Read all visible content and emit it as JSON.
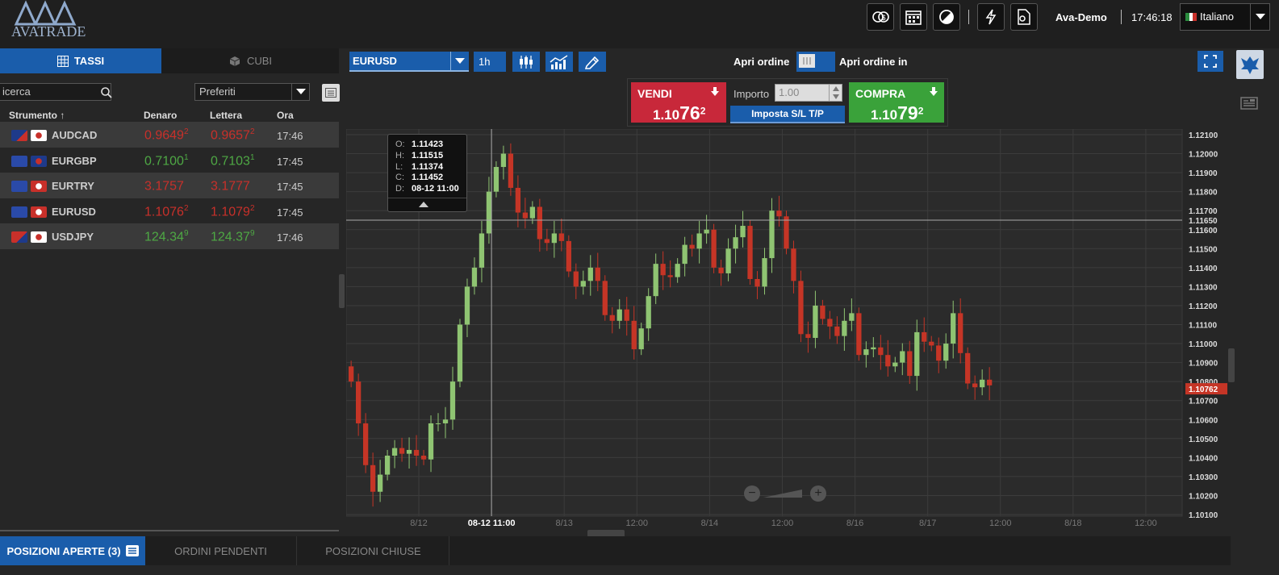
{
  "brand": {
    "logo_text": "AVATRADE"
  },
  "topbar": {
    "user": "Ava-Demo",
    "clock": "17:46:18",
    "language": "Italiano",
    "icons": [
      "currency-exchange-icon",
      "calendar-icon",
      "contrast-icon",
      "lightning-icon",
      "document-settings-icon"
    ]
  },
  "left": {
    "tabs": {
      "rates": "TASSI",
      "cubes": "CUBI"
    },
    "search_value": "icerca",
    "filter": "Preferiti",
    "headers": {
      "instrument": "Strumento",
      "bid": "Denaro",
      "ask": "Lettera",
      "time": "Ora"
    },
    "rows": [
      {
        "symbol": "AUDCAD",
        "bid_main": "0.9649",
        "bid_pip": "2",
        "ask_main": "0.9657",
        "ask_pip": "2",
        "time": "17:46",
        "dir": "red"
      },
      {
        "symbol": "EURGBP",
        "bid_main": "0.7100",
        "bid_pip": "1",
        "ask_main": "0.7103",
        "ask_pip": "1",
        "time": "17:45",
        "dir": "green"
      },
      {
        "symbol": "EURTRY",
        "bid_main": "3.1757",
        "bid_pip": "",
        "ask_main": "3.1777",
        "ask_pip": "",
        "time": "17:45",
        "dir": "red"
      },
      {
        "symbol": "EURUSD",
        "bid_main": "1.1076",
        "bid_pip": "2",
        "ask_main": "1.1079",
        "ask_pip": "2",
        "time": "17:45",
        "dir": "red"
      },
      {
        "symbol": "USDJPY",
        "bid_main": "124.34",
        "bid_pip": "9",
        "ask_main": "124.37",
        "ask_pip": "9",
        "time": "17:46",
        "dir": "green"
      }
    ]
  },
  "chart_toolbar": {
    "symbol": "EURUSD",
    "timeframe": "1h",
    "open_order": "Apri ordine",
    "open_order_in": "Apri ordine in"
  },
  "order": {
    "sell_label": "VENDI",
    "sell_pre": "1.10",
    "sell_big": "76",
    "sell_pip": "2",
    "buy_label": "COMPRA",
    "buy_pre": "1.10",
    "buy_big": "79",
    "buy_pip": "2",
    "amount_label": "Importo",
    "amount_value": "1.00",
    "sltp_label": "Imposta S/L T/P"
  },
  "tooltip": {
    "o_label": "O:",
    "o": "1.11423",
    "h_label": "H:",
    "h": "1.11515",
    "l_label": "L:",
    "l": "1.11374",
    "c_label": "C:",
    "c": "1.11452",
    "d_label": "D:",
    "d": "08-12 11:00"
  },
  "chart_data": {
    "type": "candlestick",
    "symbol": "EURUSD",
    "timeframe": "1h",
    "ylim": [
      1.101,
      1.121
    ],
    "y_ticks": [
      "1.10100",
      "1.10200",
      "1.10300",
      "1.10400",
      "1.10500",
      "1.10600",
      "1.10700",
      "1.10800",
      "1.10900",
      "1.11000",
      "1.11100",
      "1.11200",
      "1.11300",
      "1.11400",
      "1.11500",
      "1.11600",
      "1.11700",
      "1.11800",
      "1.11900",
      "1.12000",
      "1.12100"
    ],
    "hover_price": "1.11650",
    "last_price": "1.10762",
    "x_labels": [
      {
        "label": "8/12",
        "bold": false
      },
      {
        "label": "08-12 11:00",
        "bold": true
      },
      {
        "label": "8/13",
        "bold": false
      },
      {
        "label": "12:00",
        "bold": false
      },
      {
        "label": "8/14",
        "bold": false
      },
      {
        "label": "12:00",
        "bold": false
      },
      {
        "label": "8/16",
        "bold": false
      },
      {
        "label": "8/17",
        "bold": false
      },
      {
        "label": "12:00",
        "bold": false
      },
      {
        "label": "8/18",
        "bold": false
      },
      {
        "label": "12:00",
        "bold": false
      }
    ],
    "closes": [
      1.108,
      1.1058,
      1.1036,
      1.1022,
      1.1031,
      1.1041,
      1.1045,
      1.1042,
      1.1044,
      1.1041,
      1.1039,
      1.1058,
      1.1058,
      1.106,
      1.108,
      1.111,
      1.113,
      1.114,
      1.1158,
      1.118,
      1.1193,
      1.12,
      1.1182,
      1.1169,
      1.1166,
      1.1172,
      1.1155,
      1.1153,
      1.1158,
      1.1154,
      1.1138,
      1.113,
      1.1133,
      1.114,
      1.1133,
      1.1115,
      1.1112,
      1.1118,
      1.1112,
      1.1097,
      1.1108,
      1.1125,
      1.1142,
      1.1136,
      1.1135,
      1.1142,
      1.1152,
      1.115,
      1.1158,
      1.116,
      1.114,
      1.1137,
      1.115,
      1.1156,
      1.1162,
      1.1134,
      1.113,
      1.1145,
      1.117,
      1.1167,
      1.115,
      1.1133,
      1.1105,
      1.1103,
      1.112,
      1.1113,
      1.1109,
      1.1104,
      1.1112,
      1.1116,
      1.1094,
      1.1097,
      1.1098,
      1.1094,
      1.1088,
      1.109,
      1.1096,
      1.1083,
      1.1106,
      1.1101,
      1.1099,
      1.1091,
      1.11,
      1.1116,
      1.1095,
      1.1079,
      1.1077,
      1.1081,
      1.1078
    ]
  },
  "bottom_tabs": {
    "open": "POSIZIONI APERTE (3)",
    "pending": "ORDINI PENDENTI",
    "closed": "POSIZIONI CHIUSE"
  }
}
